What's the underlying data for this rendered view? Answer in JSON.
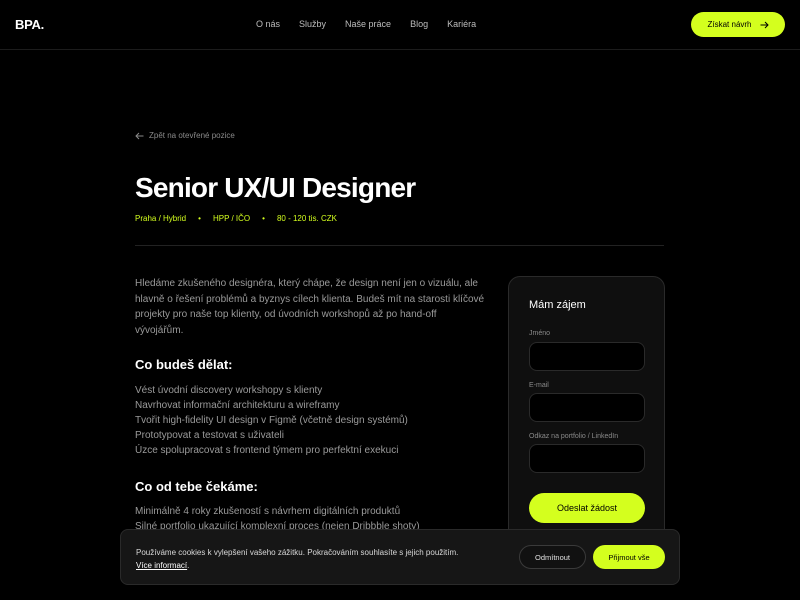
{
  "nav": {
    "logo": "BPA.",
    "links": [
      "O nás",
      "Služby",
      "Naše práce",
      "Blog",
      "Kariéra"
    ],
    "cta_label": "Získat návrh",
    "cta_icon": "arrow-right-icon"
  },
  "job": {
    "back_label": "Zpět na otevřené pozice",
    "back_icon": "arrow-left-icon",
    "title": "Senior UX/UI Designer",
    "meta": [
      "Praha / Hybrid",
      "HPP / IČO",
      "80 - 120 tis. CZK"
    ],
    "intro": "Hledáme zkušeného designéra, který chápe, že design není jen o vizuálu, ale hlavně o řešení problémů a byznys cílech klienta. Budeš mít na starosti klíčové projekty pro naše top klienty, od úvodních workshopů až po hand-off vývojářům.",
    "sections": [
      {
        "heading": "Co budeš dělat:",
        "items": [
          "Vést úvodní discovery workshopy s klienty",
          "Navrhovat informační architekturu a wireframy",
          "Tvořit high-fidelity UI design v Figmě (včetně design systémů)",
          "Prototypovat a testovat s uživateli",
          "Úzce spolupracovat s frontend týmem pro perfektní exekuci"
        ]
      },
      {
        "heading": "Co od tebe čekáme:",
        "items": [
          "Minimálně 4 roky zkušeností s návrhem digitálních produktů",
          "Silné portfolio ukazující komplexní proces (nejen Dribbble shoty)"
        ]
      }
    ]
  },
  "form": {
    "title": "Mám zájem",
    "fields": [
      {
        "label": "Jméno",
        "value": ""
      },
      {
        "label": "E-mail",
        "value": ""
      },
      {
        "label": "Odkaz na portfolio / LinkedIn",
        "value": ""
      }
    ],
    "submit_label": "Odeslat žádost"
  },
  "cookie": {
    "text": "Používáme cookies k vylepšení vašeho zážitku. Pokračováním souhlasíte s jejich použitím.",
    "more_link": "Více informací",
    "more_suffix": ".",
    "decline_label": "Odmítnout",
    "accept_label": "Přijmout vše"
  },
  "colors": {
    "accent": "#d4ff1e",
    "background": "#000000",
    "card": "#0f0f0f"
  }
}
